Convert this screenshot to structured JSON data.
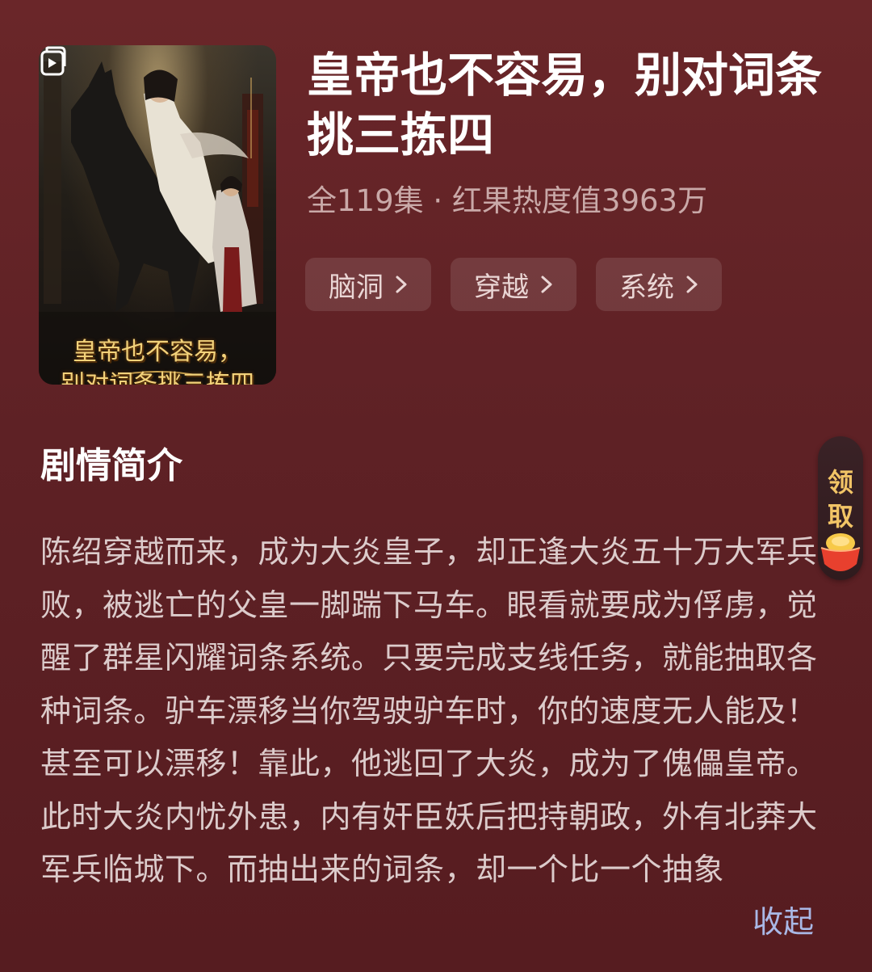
{
  "drama": {
    "title": "皇帝也不容易，别对词条挑三拣四",
    "cover_title_line1": "皇帝也不容易，",
    "cover_title_line2": "别对词条挑三拣四",
    "meta": "全119集 · 红果热度值3963万",
    "tags": [
      {
        "label": "脑洞",
        "icon": "chevron-right-icon"
      },
      {
        "label": "穿越",
        "icon": "chevron-right-icon"
      },
      {
        "label": "系统",
        "icon": "chevron-right-icon"
      }
    ]
  },
  "synopsis": {
    "heading": "剧情简介",
    "text": "陈绍穿越而来，成为大炎皇子，却正逢大炎五十万大军兵败，被逃亡的父皇一脚踹下马车。眼看就要成为俘虏，觉醒了群星闪耀词条系统。只要完成支线任务，就能抽取各种词条。驴车漂移当你驾驶驴车时，你的速度无人能及！甚至可以漂移！靠此，他逃回了大炎，成为了傀儡皇帝。此时大炎内忧外患，内有奸臣妖后把持朝政，外有北莽大军兵临城下。而抽出来的词条，却一个比一个抽象",
    "collapse_label": "收起"
  },
  "float_badge": {
    "label_line1": "领",
    "label_line2": "取",
    "icon": "coin-bowl-icon"
  },
  "colors": {
    "background": "#5e2125",
    "meta_text": "#c9a9a8",
    "link": "#a9b8e6",
    "badge_text": "#f2c466"
  }
}
